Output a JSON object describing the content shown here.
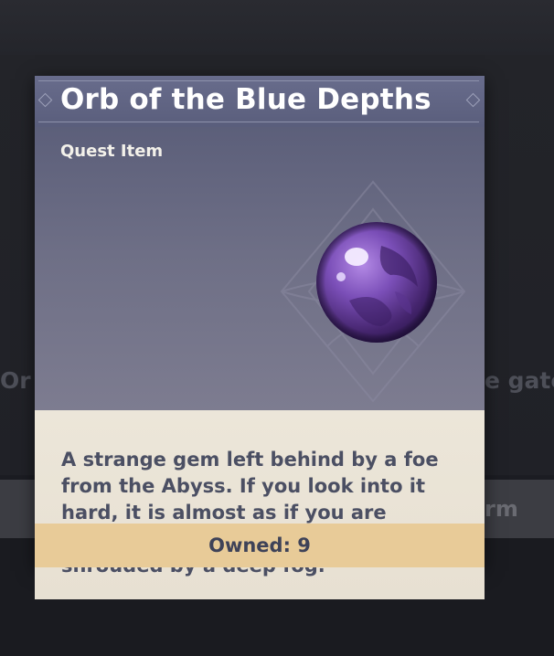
{
  "background": {
    "left_text_fragment": "Or",
    "right_text_fragment": "e gate",
    "bar_text_fragment": "rm"
  },
  "tooltip": {
    "title": "Orb of the Blue Depths",
    "type": "Quest Item",
    "description": "A strange gem left behind by a foe from the Abyss. If you look into it hard, it is almost as if you are looking into a long-borne dream shrouded by a deep fog.",
    "owned_label": "Owned: 9",
    "icon": "purple-orb-icon"
  },
  "colors": {
    "header": "#5a5e7c",
    "art_panel": "#6e6f86",
    "description_bg": "#ece6d9",
    "footer_bg": "#e8cb98",
    "orb": "#7b4fb8"
  }
}
